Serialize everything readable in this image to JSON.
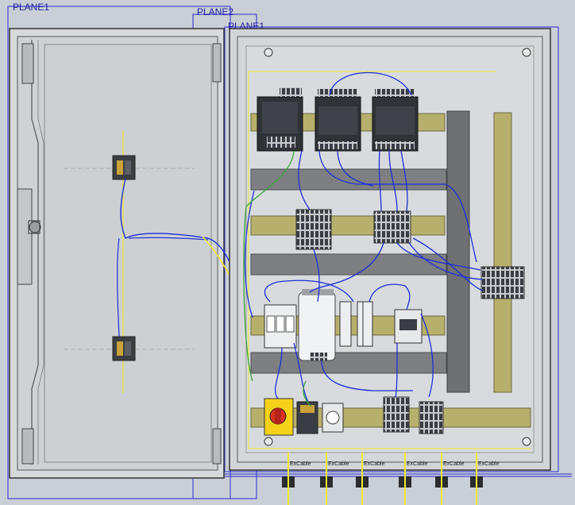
{
  "planes": [
    "PLANE1",
    "PLANE2",
    "PLANE1"
  ],
  "cable_labels": [
    "ExCable",
    "ExCable",
    "ExCable",
    "ExCable",
    "ExCable",
    "ExCable"
  ],
  "colors": {
    "background": "#c9cfd6",
    "panel": "#d2d5d8",
    "plane_outline": "#2a2ad0",
    "wire": "#1d2fd6",
    "din_rail": "#b7b06c",
    "duct": "#7d7f82",
    "ground_wire": "#f0ea2a"
  }
}
